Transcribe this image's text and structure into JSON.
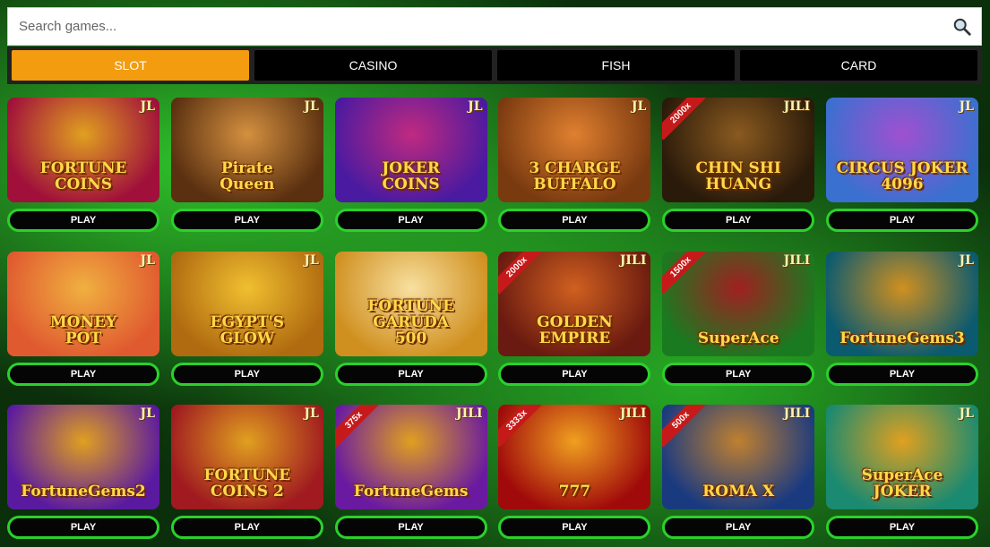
{
  "search": {
    "placeholder": "Search games..."
  },
  "tabs": [
    {
      "label": "SLOT",
      "active": true
    },
    {
      "label": "CASINO",
      "active": false
    },
    {
      "label": "FISH",
      "active": false
    },
    {
      "label": "CARD",
      "active": false
    }
  ],
  "play_label": "PLAY",
  "games": [
    {
      "title": "FORTUNE\nCOINS",
      "brand": "JL",
      "multiplier": "",
      "colors": [
        "#a0103a",
        "#e0a020"
      ]
    },
    {
      "title": "Pirate\nQueen",
      "brand": "JL",
      "multiplier": "",
      "colors": [
        "#5a3010",
        "#d49040"
      ]
    },
    {
      "title": "JOKER\nCOINS",
      "brand": "JL",
      "multiplier": "",
      "colors": [
        "#4a1aa0",
        "#c02a80"
      ]
    },
    {
      "title": "3 CHARGE\nBUFFALO",
      "brand": "JL",
      "multiplier": "",
      "colors": [
        "#7a3a10",
        "#e08030"
      ]
    },
    {
      "title": "CHIN SHI HUANG",
      "brand": "JILI",
      "multiplier": "2000x",
      "colors": [
        "#2a1a0a",
        "#8a5a20"
      ]
    },
    {
      "title": "CIRCUS JOKER\n4096",
      "brand": "JL",
      "multiplier": "",
      "colors": [
        "#3a70d0",
        "#a050d0"
      ]
    },
    {
      "title": "MONEY\nPOT",
      "brand": "JL",
      "multiplier": "",
      "colors": [
        "#e05a30",
        "#f0b040"
      ]
    },
    {
      "title": "EGYPT'S\nGLOW",
      "brand": "JL",
      "multiplier": "",
      "colors": [
        "#b06a10",
        "#f0c030"
      ]
    },
    {
      "title": "FORTUNE GARUDA\n500",
      "brand": "",
      "multiplier": "",
      "colors": [
        "#d09020",
        "#f8e0a0"
      ]
    },
    {
      "title": "GOLDEN EMPIRE",
      "brand": "JILI",
      "multiplier": "2000x",
      "colors": [
        "#6a1a10",
        "#d06020"
      ]
    },
    {
      "title": "SuperAce",
      "brand": "JILI",
      "multiplier": "1500x",
      "colors": [
        "#1a7a20",
        "#a02020"
      ]
    },
    {
      "title": "FortuneGems3",
      "brand": "JL",
      "multiplier": "",
      "colors": [
        "#0a5a70",
        "#d09020"
      ]
    },
    {
      "title": "FortuneGems2",
      "brand": "JL",
      "multiplier": "",
      "colors": [
        "#5a1aa0",
        "#e0a020"
      ]
    },
    {
      "title": "FORTUNE\nCOINS 2",
      "brand": "JL",
      "multiplier": "",
      "colors": [
        "#a01a20",
        "#e0a020"
      ]
    },
    {
      "title": "FortuneGems",
      "brand": "JILI",
      "multiplier": "375x",
      "colors": [
        "#6a1aa0",
        "#e0a020"
      ]
    },
    {
      "title": "777",
      "brand": "JILI",
      "multiplier": "3333x",
      "colors": [
        "#a00a0a",
        "#f0a020"
      ]
    },
    {
      "title": "ROMA X",
      "brand": "JILI",
      "multiplier": "500x",
      "colors": [
        "#1a3a80",
        "#c08030"
      ]
    },
    {
      "title": "SuperAce\nJOKER",
      "brand": "JL",
      "multiplier": "",
      "colors": [
        "#1a8a70",
        "#e0a020"
      ]
    }
  ]
}
